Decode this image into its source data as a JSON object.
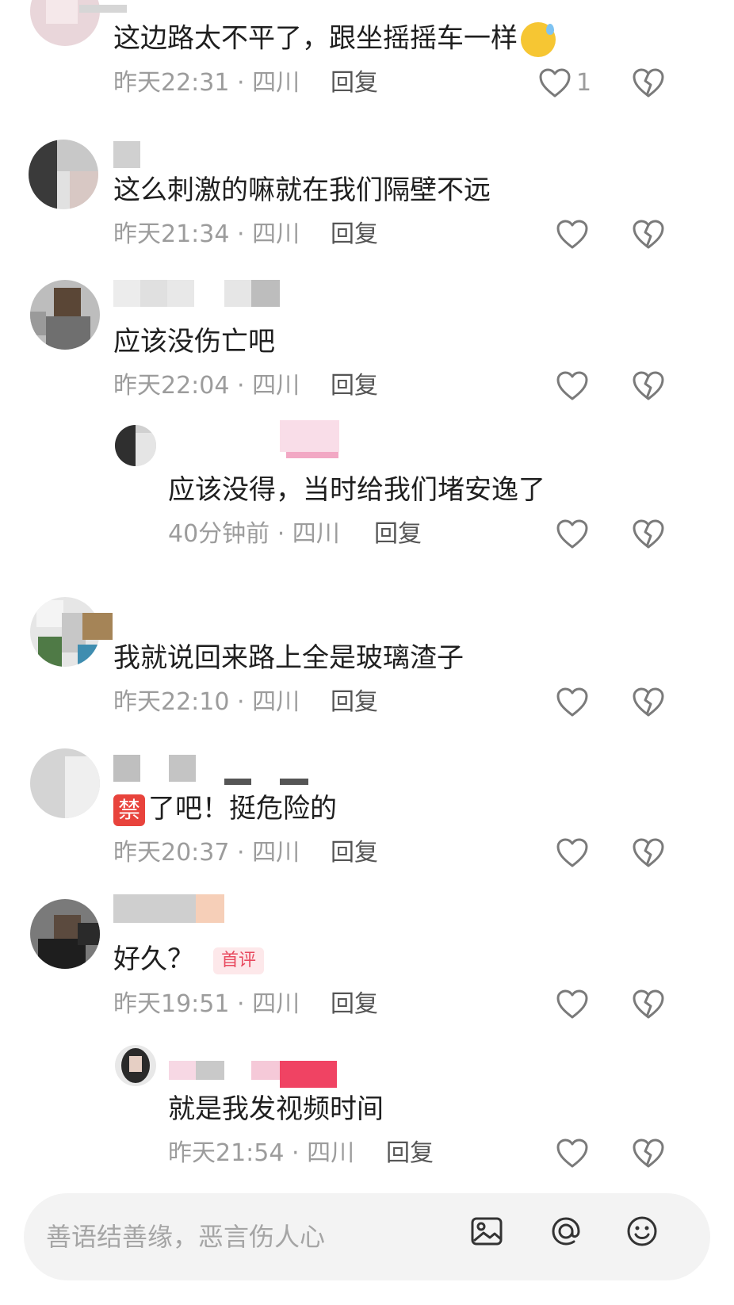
{
  "comments": [
    {
      "content": "这边路太不平了，跟坐摇摇车一样",
      "emoji": "grinning-sweat-emoji",
      "time": "昨天22:31 · 四川",
      "reply_label": "回复",
      "like_count": "1"
    },
    {
      "content": "这么刺激的嘛就在我们隔壁不远",
      "time": "昨天21:34 · 四川",
      "reply_label": "回复"
    },
    {
      "content": "应该没伤亡吧",
      "time": "昨天22:04 · 四川",
      "reply_label": "回复",
      "replies": [
        {
          "content": "应该没得，当时给我们堵安逸了",
          "time": "40分钟前 · 四川",
          "reply_label": "回复"
        }
      ]
    },
    {
      "content": "我就说回来路上全是玻璃渣子",
      "time": "昨天22:10 · 四川",
      "reply_label": "回复"
    },
    {
      "emoji_text": "禁",
      "content": "了吧！挺危险的",
      "time": "昨天20:37 · 四川",
      "reply_label": "回复"
    },
    {
      "content": "好久？",
      "badge": "首评",
      "time": "昨天19:51 · 四川",
      "reply_label": "回复",
      "replies": [
        {
          "content": "就是我发视频时间",
          "time": "昨天21:54 · 四川",
          "reply_label": "回复"
        }
      ]
    }
  ],
  "input_bar": {
    "placeholder": "善语结善缘，恶言伤人心"
  },
  "icons": {
    "like": "heart-outline-icon",
    "dislike": "broken-heart-icon",
    "image": "image-icon",
    "mention": "at-mention-icon",
    "emoji": "emoji-face-icon"
  },
  "colors": {
    "text": "#1f1f1f",
    "meta": "#9c9c9c",
    "badge": "#e84a5f"
  }
}
